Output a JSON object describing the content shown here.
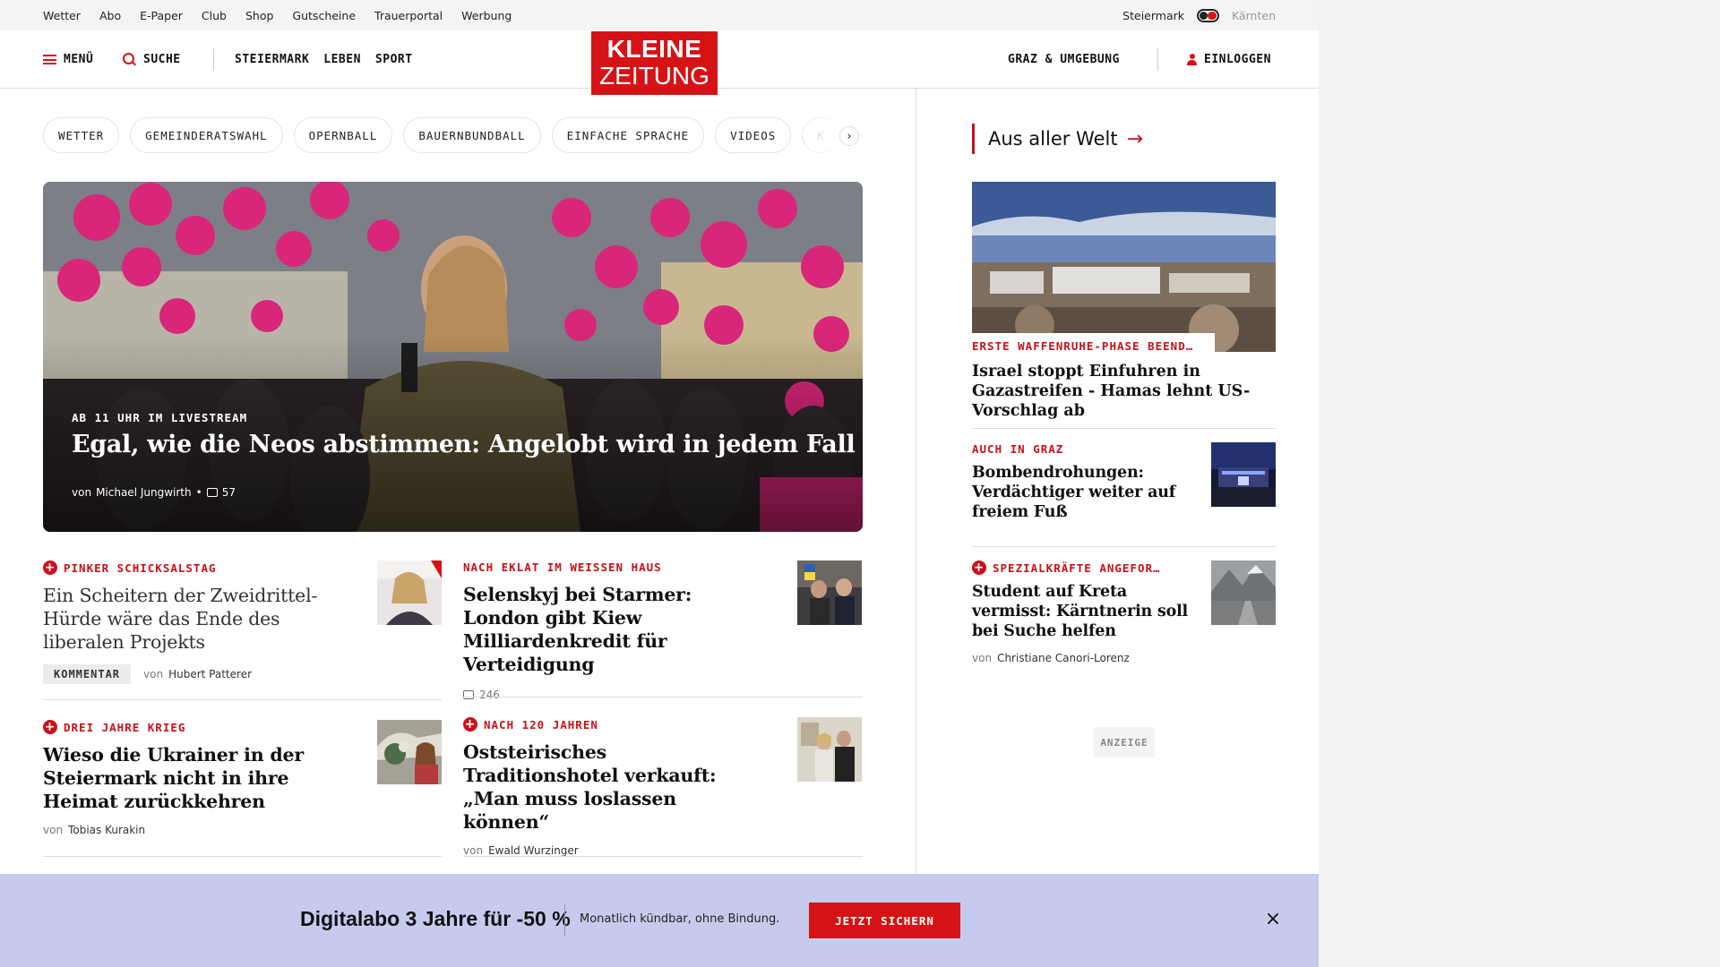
{
  "topbar": {
    "links": [
      "Wetter",
      "Abo",
      "E-Paper",
      "Club",
      "Shop",
      "Gutscheine",
      "Trauerportal",
      "Werbung"
    ],
    "region_active": "Steiermark",
    "region_inactive": "Kärnten"
  },
  "header": {
    "menu_label": "MENÜ",
    "search_label": "SUCHE",
    "sections": [
      "STEIERMARK",
      "LEBEN",
      "SPORT"
    ],
    "logo_line1": "KLEINE",
    "logo_line2": "ZEITUNG",
    "graz_label": "GRAZ & UMGEBUNG",
    "login_label": "EINLOGGEN"
  },
  "tags": [
    "WETTER",
    "GEMEINDERATSWAHL",
    "OPERNBALL",
    "BAUERNBUNDBALL",
    "EINFACHE SPRACHE",
    "VIDEOS",
    "K"
  ],
  "hero": {
    "kicker": "AB 11 UHR IM LIVESTREAM",
    "title": "Egal, wie die Neos abstimmen: Angelobt wird in jedem Fall",
    "author_prefix": "von",
    "author": "Michael Jungwirth",
    "comments": "57"
  },
  "cards": [
    {
      "kicker": "PINKER SCHICKSALSTAG",
      "premium": true,
      "title": "Ein Scheitern der Zweidrittel-Hürde wäre das Ende des liberalen Projekts",
      "badge": "KOMMENTAR",
      "author_prefix": "von",
      "author": "Hubert Patterer",
      "comments": ""
    },
    {
      "kicker": "NACH EKLAT IM WEISSEN HAUS",
      "premium": false,
      "title": "Selenskyj bei Starmer: London gibt Kiew Milliardenkredit für Verteidigung",
      "badge": "",
      "author_prefix": "",
      "author": "",
      "comments": "246"
    },
    {
      "kicker": "DREI JAHRE KRIEG",
      "premium": true,
      "title": "Wieso die Ukrainer in der Steiermark nicht in ihre Heimat zurückkehren",
      "badge": "",
      "author_prefix": "von",
      "author": "Tobias Kurakin",
      "comments": ""
    },
    {
      "kicker": "NACH 120 JAHREN",
      "premium": true,
      "title": "Oststeirisches Traditionshotel verkauft: „Man muss loslassen können“",
      "badge": "",
      "author_prefix": "von",
      "author": "Ewald Wurzinger",
      "comments": ""
    }
  ],
  "sidebar": {
    "heading": "Aus aller Welt",
    "top": {
      "kicker": "ERSTE WAFFENRUHE-PHASE BEEND…",
      "title": "Israel stoppt Einfuhren in Gazastreifen - Hamas lehnt US-Vorschlag ab"
    },
    "items": [
      {
        "kicker": "AUCH IN GRAZ",
        "premium": false,
        "title": "Bombendrohungen: Verdächtiger weiter auf freiem Fuß",
        "author_prefix": "",
        "author": ""
      },
      {
        "kicker": "SPEZIALKRÄFTE ANGEFOR…",
        "premium": true,
        "title": "Student auf Kreta vermisst: Kärntnerin soll bei Suche helfen",
        "author_prefix": "von",
        "author": "Christiane Canori-Lorenz"
      }
    ],
    "ad_label": "ANZEIGE"
  },
  "promo": {
    "title": "Digitalabo 3 Jahre für -50 %",
    "subtitle": "Monatlich kündbar, ohne Bindung.",
    "button": "JETZT SICHERN",
    "close": "×"
  },
  "colors": {
    "brand_red": "#d51317",
    "kicker_red": "#c8111a",
    "promo_bg": "#c6cbee"
  }
}
